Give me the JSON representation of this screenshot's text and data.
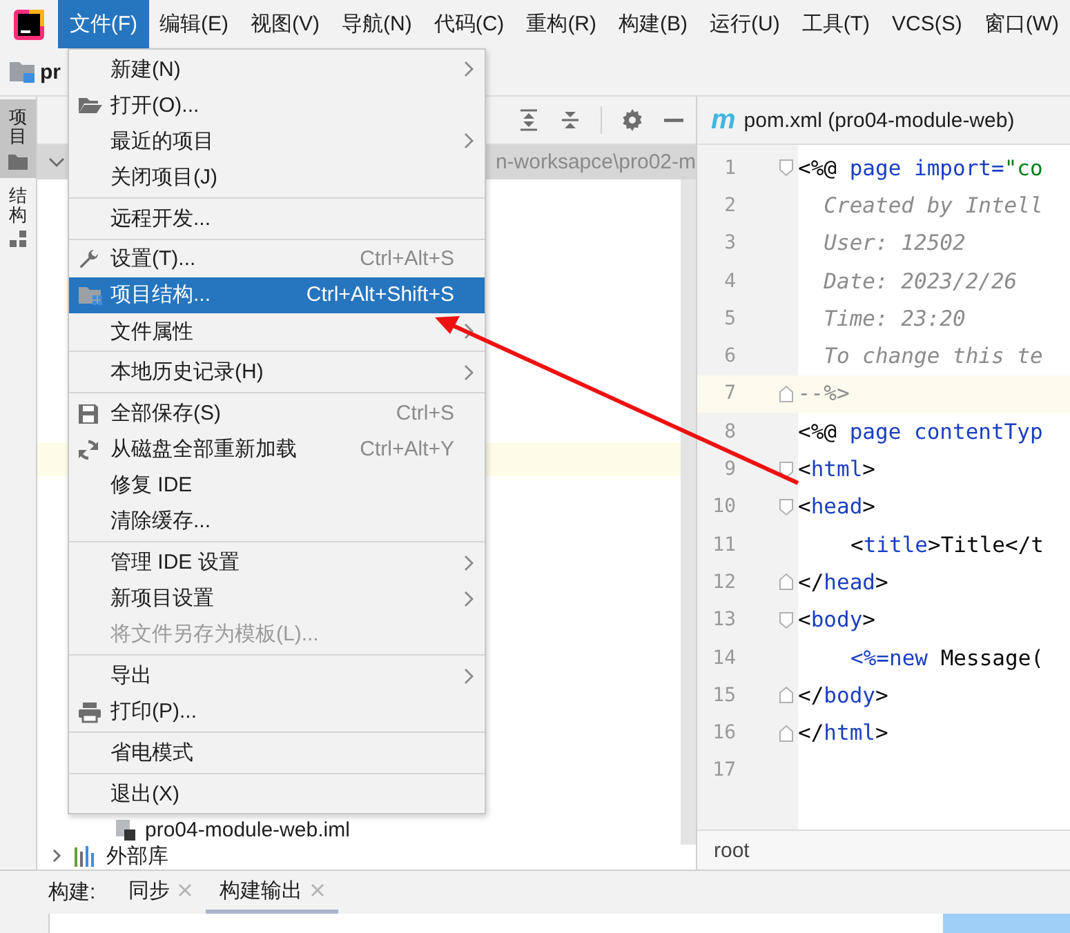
{
  "menubar": {
    "items": [
      {
        "label": "文件(F)",
        "selected": true
      },
      {
        "label": "编辑(E)",
        "selected": false
      },
      {
        "label": "视图(V)",
        "selected": false
      },
      {
        "label": "导航(N)",
        "selected": false
      },
      {
        "label": "代码(C)",
        "selected": false
      },
      {
        "label": "重构(R)",
        "selected": false
      },
      {
        "label": "构建(B)",
        "selected": false
      },
      {
        "label": "运行(U)",
        "selected": false
      },
      {
        "label": "工具(T)",
        "selected": false
      },
      {
        "label": "VCS(S)",
        "selected": false
      },
      {
        "label": "窗口(W)",
        "selected": false
      }
    ]
  },
  "navbar": {
    "breadcrumb": "pr"
  },
  "tool_strip": {
    "tabs": [
      {
        "label": "项目",
        "selected": true
      },
      {
        "label": "结构",
        "selected": false
      }
    ]
  },
  "project_panel": {
    "path": "n-worksapce\\pro02-m",
    "tree": [
      {
        "label": "pro04-module-web.iml",
        "kind": "file"
      },
      {
        "label": "外部库",
        "kind": "library",
        "expanded": false
      }
    ]
  },
  "editor": {
    "tab": {
      "file_icon": "m",
      "label": "pom.xml (pro04-module-web)"
    },
    "breadcrumb": "root",
    "lines": [
      {
        "number": "1",
        "current": false,
        "kind": "start",
        "tokens": [
          {
            "kind": "text",
            "text": "<%@ "
          },
          {
            "kind": "keyword",
            "text": "page import="
          },
          {
            "kind": "string",
            "text": "\"co"
          }
        ]
      },
      {
        "number": "2",
        "current": false,
        "kind": "plain",
        "tokens": [
          {
            "kind": "comment",
            "text": "  Created by Intell"
          }
        ]
      },
      {
        "number": "3",
        "current": false,
        "kind": "plain",
        "tokens": [
          {
            "kind": "comment",
            "text": "  User: 12502"
          }
        ]
      },
      {
        "number": "4",
        "current": false,
        "kind": "plain",
        "tokens": [
          {
            "kind": "comment",
            "text": "  Date: 2023/2/26"
          }
        ]
      },
      {
        "number": "5",
        "current": false,
        "kind": "plain",
        "tokens": [
          {
            "kind": "comment",
            "text": "  Time: 23:20"
          }
        ]
      },
      {
        "number": "6",
        "current": false,
        "kind": "plain",
        "tokens": [
          {
            "kind": "comment",
            "text": "  To change this te"
          }
        ]
      },
      {
        "number": "7",
        "current": true,
        "kind": "end",
        "tokens": [
          {
            "kind": "comment",
            "text": "--%>"
          }
        ]
      },
      {
        "number": "8",
        "current": false,
        "kind": "plain",
        "tokens": [
          {
            "kind": "text",
            "text": "<%@ "
          },
          {
            "kind": "keyword",
            "text": "page contentTyp"
          }
        ]
      },
      {
        "number": "9",
        "current": false,
        "kind": "start",
        "tokens": [
          {
            "kind": "text",
            "text": "<"
          },
          {
            "kind": "keyword",
            "text": "html"
          },
          {
            "kind": "text",
            "text": ">"
          }
        ]
      },
      {
        "number": "10",
        "current": false,
        "kind": "start",
        "tokens": [
          {
            "kind": "text",
            "text": "<"
          },
          {
            "kind": "keyword",
            "text": "head"
          },
          {
            "kind": "text",
            "text": ">"
          }
        ]
      },
      {
        "number": "11",
        "current": false,
        "kind": "indented",
        "tokens": [
          {
            "kind": "text",
            "text": "<"
          },
          {
            "kind": "keyword",
            "text": "title"
          },
          {
            "kind": "text",
            "text": ">Title</t"
          }
        ]
      },
      {
        "number": "12",
        "current": false,
        "kind": "end",
        "tokens": [
          {
            "kind": "text",
            "text": "</"
          },
          {
            "kind": "keyword",
            "text": "head"
          },
          {
            "kind": "text",
            "text": ">"
          }
        ]
      },
      {
        "number": "13",
        "current": false,
        "kind": "start",
        "tokens": [
          {
            "kind": "text",
            "text": "<"
          },
          {
            "kind": "keyword",
            "text": "body"
          },
          {
            "kind": "text",
            "text": ">"
          }
        ]
      },
      {
        "number": "14",
        "current": false,
        "kind": "indented",
        "tokens": [
          {
            "kind": "keyword",
            "text": "<%=new "
          },
          {
            "kind": "text",
            "text": "Message("
          }
        ]
      },
      {
        "number": "15",
        "current": false,
        "kind": "end",
        "tokens": [
          {
            "kind": "text",
            "text": "</"
          },
          {
            "kind": "keyword",
            "text": "body"
          },
          {
            "kind": "text",
            "text": ">"
          }
        ]
      },
      {
        "number": "16",
        "current": false,
        "kind": "end",
        "tokens": [
          {
            "kind": "text",
            "text": "</"
          },
          {
            "kind": "keyword",
            "text": "html"
          },
          {
            "kind": "text",
            "text": ">"
          }
        ]
      },
      {
        "number": "17",
        "current": false,
        "kind": "plain"
      }
    ]
  },
  "bottom_panel": {
    "title": "构建:",
    "tabs": [
      {
        "label": "同步",
        "selected": false
      },
      {
        "label": "构建输出",
        "selected": true
      }
    ]
  },
  "file_menu": {
    "items": [
      {
        "label": "新建(N)",
        "kind": "plain",
        "submenu": true,
        "disabled": false,
        "selected": false,
        "separator_before": false
      },
      {
        "label": "打开(O)...",
        "kind": "open",
        "submenu": false,
        "disabled": false,
        "selected": false,
        "separator_before": false
      },
      {
        "label": "最近的项目",
        "kind": "plain",
        "submenu": true,
        "disabled": false,
        "selected": false,
        "separator_before": false
      },
      {
        "label": "关闭项目(J)",
        "kind": "plain",
        "submenu": false,
        "disabled": false,
        "selected": false,
        "separator_before": false
      },
      {
        "label": "远程开发...",
        "kind": "plain",
        "submenu": false,
        "disabled": false,
        "selected": false,
        "separator_before": true
      },
      {
        "label": "设置(T)...",
        "shortcut": "Ctrl+Alt+S",
        "kind": "settings",
        "submenu": false,
        "disabled": false,
        "selected": false,
        "separator_before": true
      },
      {
        "label": "项目结构...",
        "shortcut": "Ctrl+Alt+Shift+S",
        "kind": "structure",
        "submenu": false,
        "disabled": false,
        "selected": true,
        "separator_before": false
      },
      {
        "label": "文件属性",
        "kind": "plain",
        "submenu": true,
        "disabled": false,
        "selected": false,
        "separator_before": false
      },
      {
        "label": "本地历史记录(H)",
        "kind": "plain",
        "submenu": true,
        "disabled": false,
        "selected": false,
        "separator_before": true
      },
      {
        "label": "全部保存(S)",
        "shortcut": "Ctrl+S",
        "kind": "save",
        "submenu": false,
        "disabled": false,
        "selected": false,
        "separator_before": true
      },
      {
        "label": "从磁盘全部重新加载",
        "shortcut": "Ctrl+Alt+Y",
        "kind": "reload",
        "submenu": false,
        "disabled": false,
        "selected": false,
        "separator_before": false
      },
      {
        "label": "修复 IDE",
        "kind": "plain",
        "submenu": false,
        "disabled": false,
        "selected": false,
        "separator_before": false
      },
      {
        "label": "清除缓存...",
        "kind": "plain",
        "submenu": false,
        "disabled": false,
        "selected": false,
        "separator_before": false
      },
      {
        "label": "管理 IDE 设置",
        "kind": "plain",
        "submenu": true,
        "disabled": false,
        "selected": false,
        "separator_before": true
      },
      {
        "label": "新项目设置",
        "kind": "plain",
        "submenu": true,
        "disabled": false,
        "selected": false,
        "separator_before": false
      },
      {
        "label": "将文件另存为模板(L)...",
        "kind": "plain",
        "submenu": false,
        "disabled": true,
        "selected": false,
        "separator_before": false
      },
      {
        "label": "导出",
        "kind": "plain",
        "submenu": true,
        "disabled": false,
        "selected": false,
        "separator_before": true
      },
      {
        "label": "打印(P)...",
        "kind": "print",
        "submenu": false,
        "disabled": false,
        "selected": false,
        "separator_before": false
      },
      {
        "label": "省电模式",
        "kind": "plain",
        "submenu": false,
        "disabled": false,
        "selected": false,
        "separator_before": true
      },
      {
        "label": "退出(X)",
        "kind": "plain",
        "submenu": false,
        "disabled": false,
        "selected": false,
        "separator_before": true
      }
    ]
  }
}
